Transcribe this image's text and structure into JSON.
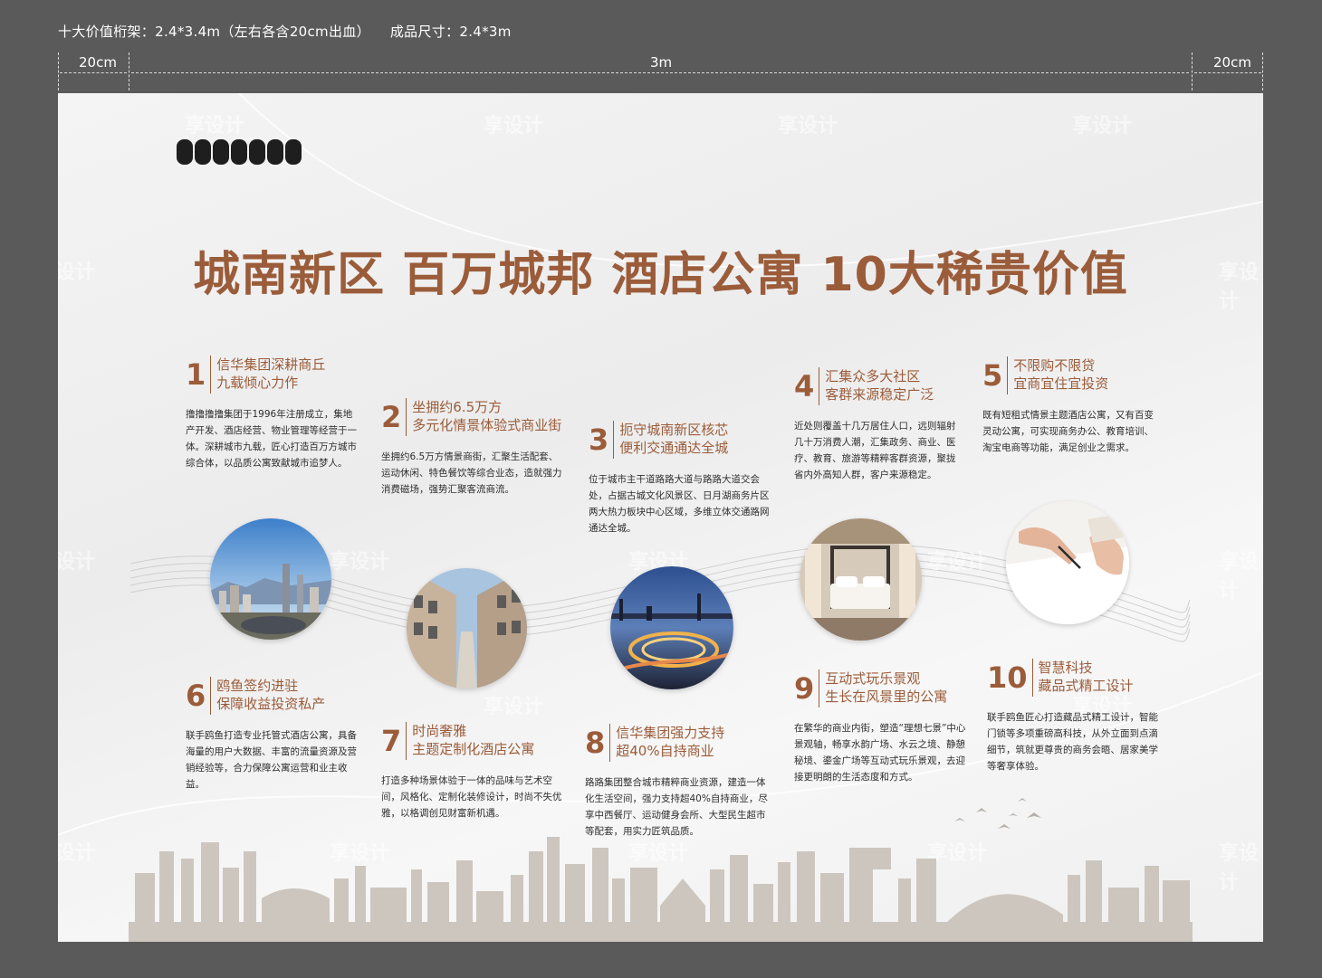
{
  "spec": {
    "frame": "十大价值桁架：2.4*3.4m（左右各含20cm出血）",
    "finished": "成品尺寸：2.4*3m"
  },
  "dims": {
    "left": "20cm",
    "center": "3m",
    "right": "20cm"
  },
  "headline": "城南新区 百万城邦 酒店公寓 10大稀贵价值",
  "watermark": "享设计",
  "colors": {
    "accent": "#9b5c3a",
    "board": "#f2f2f2",
    "skyline": "#c9c2bc"
  },
  "items": [
    {
      "num": "1",
      "title1": "信华集团深耕商丘",
      "title2": "九载倾心力作",
      "text": "撸撸撸撸集团于1996年注册成立，集地产开发、酒店经营、物业管理等经营于一体。深耕城市九载，匠心打造百万方城市综合体，以品质公寓致献城市追梦人。"
    },
    {
      "num": "2",
      "title1": "坐拥约6.5万方",
      "title2": "多元化情景体验式商业街",
      "text": "坐拥约6.5万方情景商街，汇聚生活配套、运动休闲、特色餐饮等综合业态，造就强力消费磁场，强势汇聚客流商流。"
    },
    {
      "num": "3",
      "title1": "扼守城南新区核芯",
      "title2": "便利交通通达全城",
      "text": "位于城市主干道路路大道与路路大道交会处，占据古城文化风景区、日月湖商务片区两大热力板块中心区域，多维立体交通路网通达全城。"
    },
    {
      "num": "4",
      "title1": "汇集众多大社区",
      "title2": "客群来源稳定广泛",
      "text": "近处则覆盖十几万居住人口，远则辐射几十万消费人潮，汇集政务、商业、医疗、教育、旅游等精粹客群资源，聚拢省内外高知人群，客户来源稳定。"
    },
    {
      "num": "5",
      "title1": "不限购不限贷",
      "title2": "宜商宜住宜投资",
      "text": "既有短租式情景主题酒店公寓，又有百变灵动公寓，可实现商务办公、教育培训、淘宝电商等功能，满足创业之需求。"
    },
    {
      "num": "6",
      "title1": "鸥鱼签约进驻",
      "title2": "保障收益投资私产",
      "text": "联手鸥鱼打造专业托管式酒店公寓，具备海量的用户大数据、丰富的流量资源及营销经验等，合力保障公寓运营和业主收益。"
    },
    {
      "num": "7",
      "title1": "时尚奢雅",
      "title2": "主题定制化酒店公寓",
      "text": "打造多种场景体验于一体的品味与艺术空间，风格化、定制化装修设计，时尚不失优雅，以格调创见财富新机遇。"
    },
    {
      "num": "8",
      "title1": "信华集团强力支持",
      "title2": "超40%自持商业",
      "text": "路路集团整合城市精粹商业资源，建造一体化生活空间，强力支持超40%自持商业，尽享中西餐厅、运动健身会所、大型民生超市等配套，用实力匠筑品质。"
    },
    {
      "num": "9",
      "title1": "互动式玩乐景观",
      "title2": "生长在风景里的公寓",
      "text": "在繁华的商业内街，塑造“理想七景”中心景观轴，畅享水韵广场、水云之境、静憩秘境、鎏金广场等互动式玩乐景观，去迎接更明朗的生活态度和方式。"
    },
    {
      "num": "10",
      "title1": "智慧科技",
      "title2": "藏品式精工设计",
      "text": "联手鸥鱼匠心打造藏品式精工设计，智能门锁等多项重磅高科技，从外立面到点滴细节，筑就更尊贵的商务会晤、居家美学等奢享体验。"
    }
  ]
}
